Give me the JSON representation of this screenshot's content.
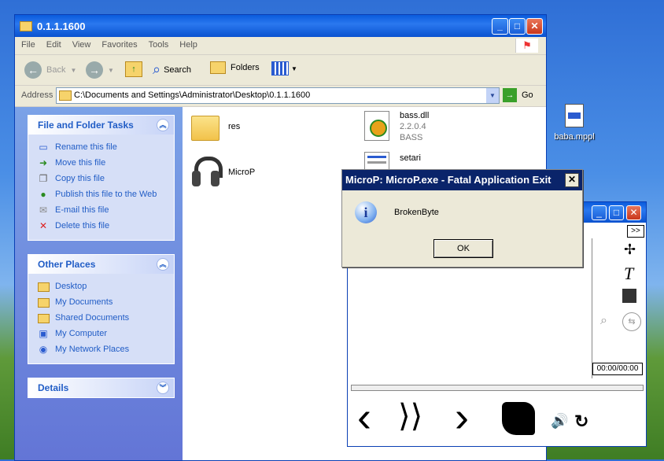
{
  "desktop": {
    "icon_label": "baba.mppl"
  },
  "explorer": {
    "title": "0.1.1.1600",
    "menu": [
      "File",
      "Edit",
      "View",
      "Favorites",
      "Tools",
      "Help"
    ],
    "toolbar": {
      "back_label": "Back",
      "search_label": "Search",
      "folders_label": "Folders"
    },
    "address": {
      "label": "Address",
      "value": "C:\\Documents and Settings\\Administrator\\Desktop\\0.1.1.1600",
      "go_label": "Go"
    },
    "file_tasks": {
      "title": "File and Folder Tasks",
      "items": [
        {
          "label": "Rename this file",
          "icon": "rename-icon"
        },
        {
          "label": "Move this file",
          "icon": "move-icon"
        },
        {
          "label": "Copy this file",
          "icon": "copy-icon"
        },
        {
          "label": "Publish this file to the Web",
          "icon": "publish-icon"
        },
        {
          "label": "E-mail this file",
          "icon": "email-icon"
        },
        {
          "label": "Delete this file",
          "icon": "delete-icon"
        }
      ]
    },
    "other_places": {
      "title": "Other Places",
      "items": [
        {
          "label": "Desktop",
          "icon": "folder-icon"
        },
        {
          "label": "My Documents",
          "icon": "folder-icon"
        },
        {
          "label": "Shared Documents",
          "icon": "folder-icon"
        },
        {
          "label": "My Computer",
          "icon": "computer-icon"
        },
        {
          "label": "My Network Places",
          "icon": "network-icon"
        }
      ]
    },
    "details": {
      "title": "Details"
    },
    "files": [
      {
        "name": "res",
        "type": "folder"
      },
      {
        "name": "MicroP",
        "type": "application"
      },
      {
        "name": "bass.dll",
        "version": "2.2.0.4",
        "desc": "BASS"
      },
      {
        "name": "setari",
        "type": "config"
      }
    ]
  },
  "dialog": {
    "title": "MicroP: MicroP.exe - Fatal Application Exit",
    "message": "BrokenByte",
    "ok_label": "OK"
  },
  "player": {
    "expand_label": ">>",
    "time": "00:00/00:00"
  }
}
